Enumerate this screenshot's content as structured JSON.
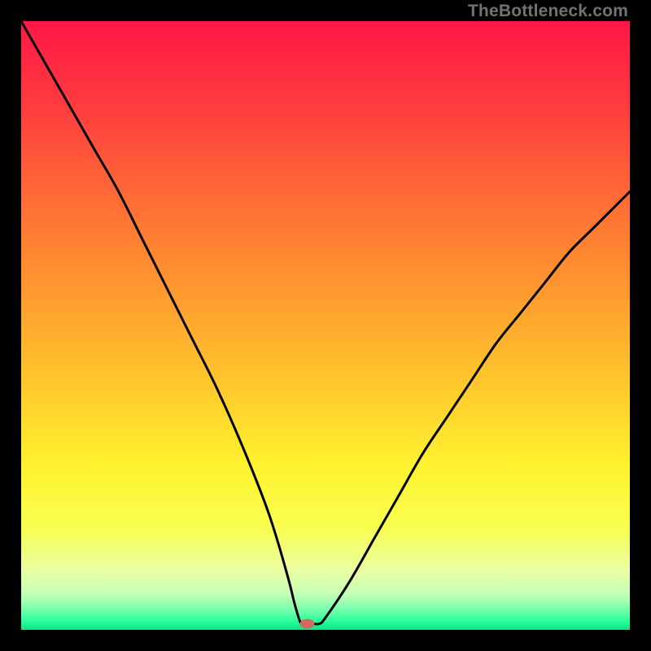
{
  "watermark": "TheBottleneck.com",
  "chart_data": {
    "type": "line",
    "title": "",
    "xlabel": "",
    "ylabel": "",
    "xlim": [
      0,
      100
    ],
    "ylim": [
      0,
      100
    ],
    "grid": false,
    "legend": false,
    "annotations": [],
    "series": [
      {
        "name": "curve",
        "x": [
          0,
          4,
          8,
          12,
          16,
          20,
          24,
          28,
          32,
          36,
          40,
          42,
          44,
          45,
          46,
          47,
          48,
          49,
          50,
          54,
          58,
          62,
          66,
          70,
          74,
          78,
          82,
          86,
          90,
          94,
          98,
          100
        ],
        "y": [
          100,
          93,
          86,
          79,
          72,
          64,
          56,
          48,
          40,
          31,
          21,
          15,
          8,
          4,
          1,
          1,
          1,
          1,
          2,
          8,
          15,
          22,
          29,
          35,
          41,
          47,
          52,
          57,
          62,
          66,
          70,
          72
        ],
        "comment": "V-shaped bottleneck curve; minimum (optimal match) near x≈46–49 at y≈1. Values estimated from pixel positions on a 0–100 axis in each direction."
      }
    ],
    "marker": {
      "name": "optimal-point",
      "x": 47,
      "y": 1,
      "color": "#cf6a5e"
    },
    "background_gradient": {
      "stops": [
        {
          "pos": 0.0,
          "color": "#ff1846"
        },
        {
          "pos": 0.14,
          "color": "#ff3c3f"
        },
        {
          "pos": 0.3,
          "color": "#ff6e35"
        },
        {
          "pos": 0.45,
          "color": "#ff9b2f"
        },
        {
          "pos": 0.6,
          "color": "#ffc92c"
        },
        {
          "pos": 0.73,
          "color": "#fff22f"
        },
        {
          "pos": 0.83,
          "color": "#f8ff4e"
        },
        {
          "pos": 0.9,
          "color": "#ecffa0"
        },
        {
          "pos": 0.94,
          "color": "#c7ffb6"
        },
        {
          "pos": 0.965,
          "color": "#7dffae"
        },
        {
          "pos": 0.985,
          "color": "#2dff9c"
        },
        {
          "pos": 1.0,
          "color": "#06e58a"
        }
      ]
    }
  }
}
